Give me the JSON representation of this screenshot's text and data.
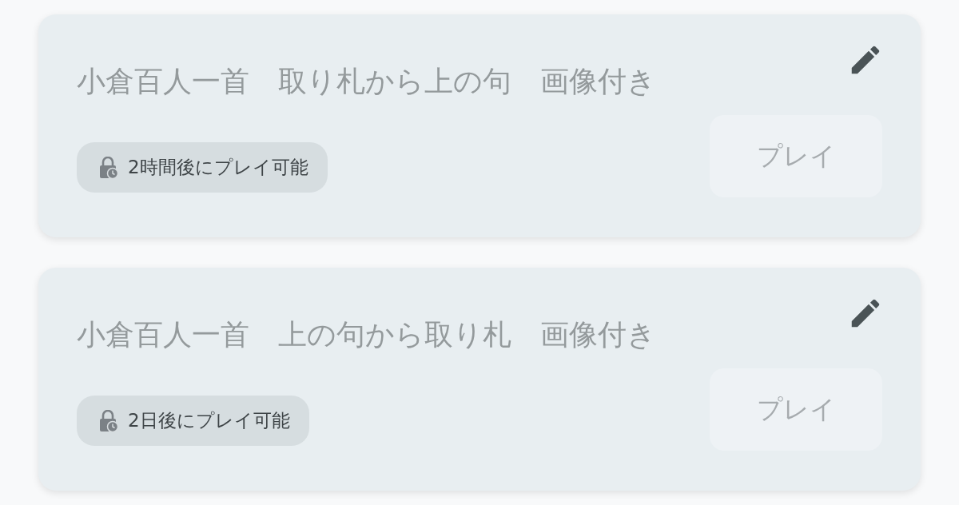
{
  "cards": [
    {
      "title": "小倉百人一首　取り札から上の句　画像付き",
      "badge": "2時間後にプレイ可能",
      "locked": true,
      "play_button": {
        "label": "プレイ",
        "disabled": true
      }
    },
    {
      "title": "小倉百人一首　上の句から取り札　画像付き",
      "badge": "2日後にプレイ可能",
      "locked": true,
      "play_button": {
        "label": "プレイ",
        "disabled": true
      }
    }
  ]
}
